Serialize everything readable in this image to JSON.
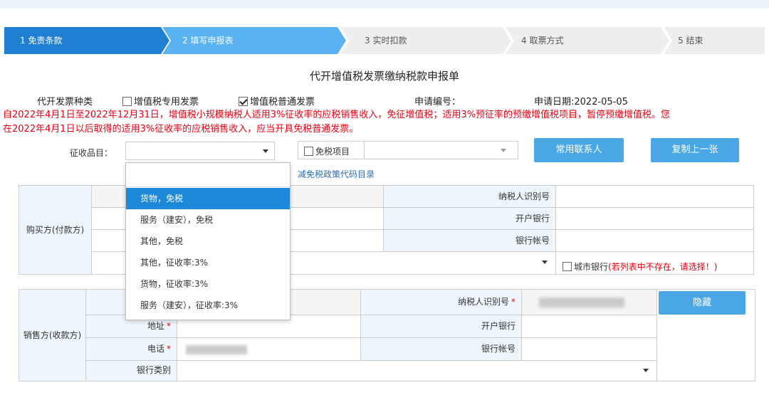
{
  "steps": [
    {
      "label": "1 免责条款",
      "state": "active"
    },
    {
      "label": "2 填写申报表",
      "state": "current"
    },
    {
      "label": "3 实时扣款",
      "state": "todo"
    },
    {
      "label": "4 取票方式",
      "state": "todo"
    },
    {
      "label": "5 结束",
      "state": "todo"
    }
  ],
  "colors": {
    "step_active": "#1f7fd0",
    "step_current": "#5bb2f0",
    "step_todo": "#eeeeee",
    "notice": "#e60012",
    "button": "#4aa7e6",
    "highlight": "#1e88d8"
  },
  "form": {
    "title": "代开增值税发票缴纳税款申报单",
    "invoice_type_label": "代开发票种类",
    "opt_special": "增值税专用发票",
    "opt_special_checked": false,
    "opt_general": "增值税普通发票",
    "opt_general_checked": true,
    "app_no_label": "申请编号：",
    "app_date": "申请日期:2022-05-05",
    "notice_line1": "自2022年4月1日至2022年12月31日，增值税小规模纳税人适用3%征收率的应税销售收入，免征增值税；适用3%预征率的预缴增值税项目，暂停预缴增值税。您",
    "notice_line2": "在2022年4月1日以后取得的适用3%征收率的应税销售收入，应当开具免税普通发票。"
  },
  "selection": {
    "item_label": "征收品目：",
    "exempt_label": "免税项目",
    "btn_contact": "常用联系人",
    "btn_copy": "复制上一张",
    "policy_link": "减免税政策代码目录"
  },
  "dropdown": {
    "items": [
      "货物，免税",
      "服务（建安），免税",
      "其他，免税",
      "其他，征收率:3%",
      "货物，征收率:3%",
      "服务（建安），征收率:3%"
    ],
    "highlighted": 0
  },
  "buyer": {
    "side_label": "购买方(付款方)",
    "taxid_label": "纳税人识别号",
    "bank_label": "开户银行",
    "account_label": "银行帐号",
    "city_bank_label": "城市银行",
    "city_bank_hint": "(若列表中不存在，请选择！)"
  },
  "seller": {
    "side_label": "销售方(收款方)",
    "taxid_label": "纳税人识别号",
    "address_label": "地址",
    "phone_label": "电话",
    "bank_label": "开户银行",
    "account_label": "银行帐号",
    "bank_type_label": "银行类别",
    "btn_hide": "隐藏",
    "required_mark": "*"
  }
}
